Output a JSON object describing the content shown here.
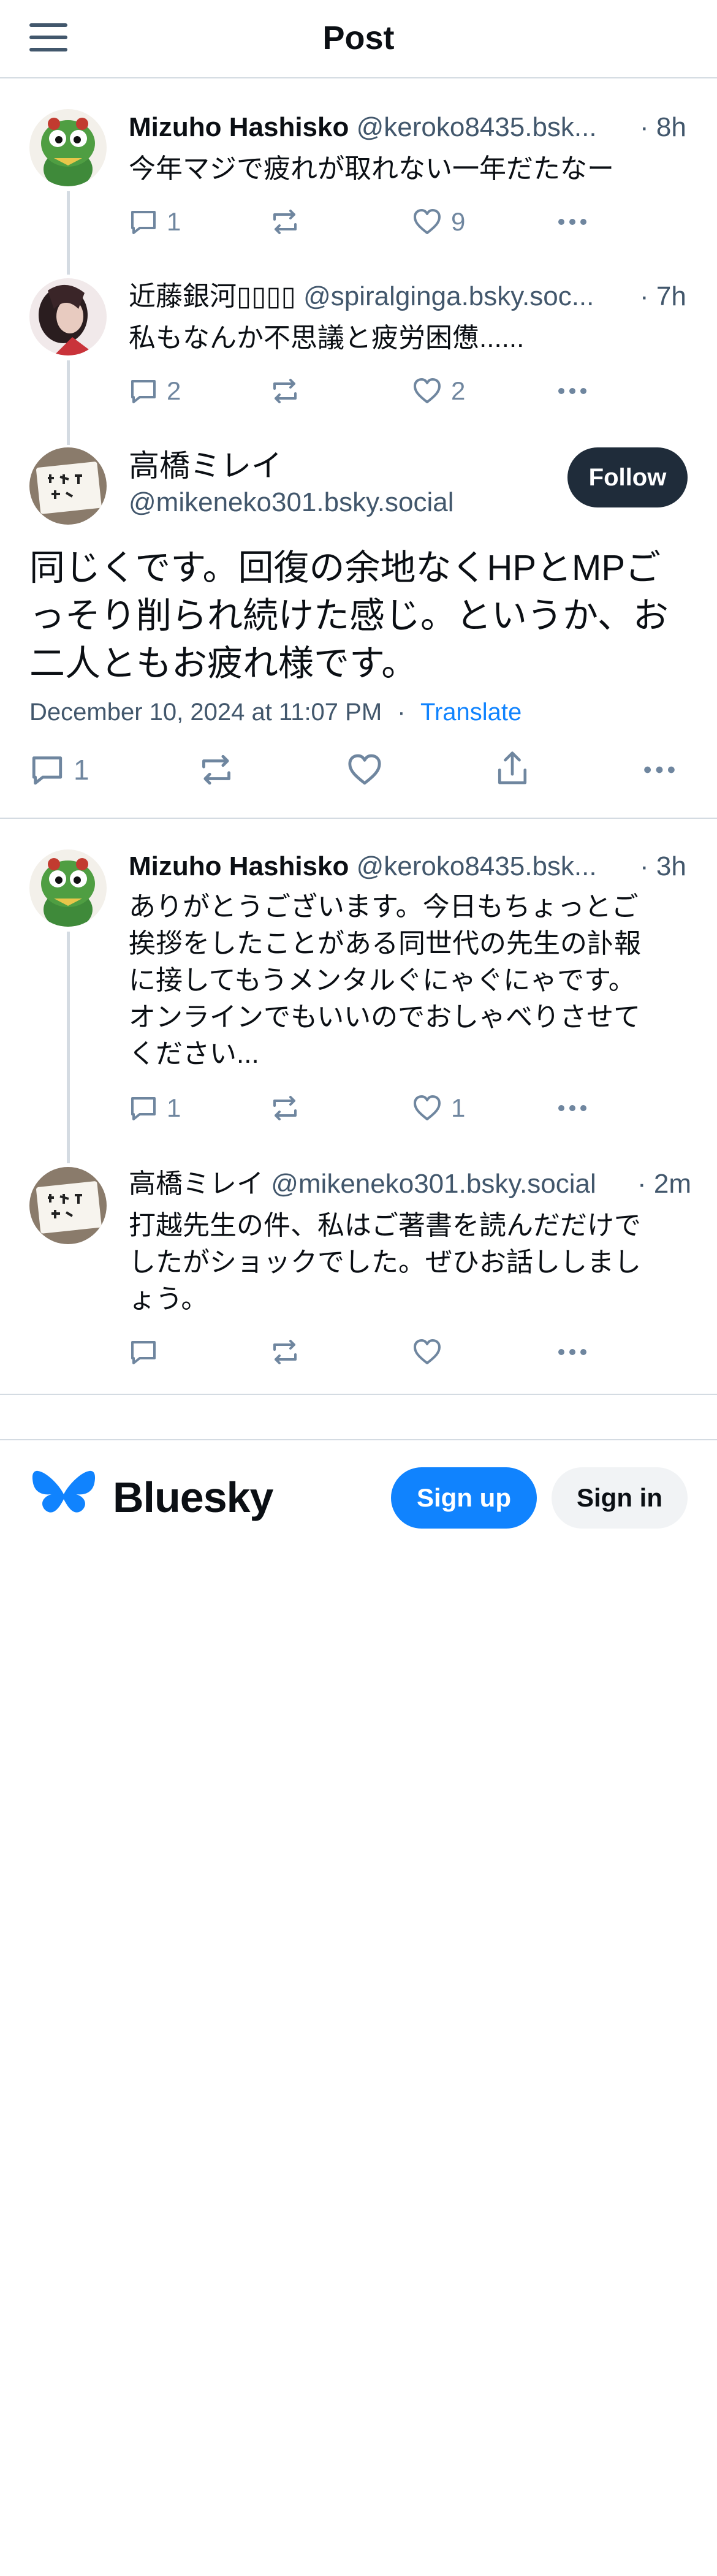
{
  "header": {
    "title": "Post",
    "menu_icon": "hamburger-menu-icon"
  },
  "posts": [
    {
      "author_name": "Mizuho Hashisko",
      "handle": "@keroko8435.bsk...",
      "time": "· 8h",
      "text": "今年マジで疲れが取れない一年だたなー",
      "replies": "1",
      "reposts": "",
      "likes": "9"
    },
    {
      "author_name": "近藤銀河",
      "author_emoji_glyphs": "▯▯▯▯",
      "handle": "@spiralginga.bsky.soc...",
      "time": "· 7h",
      "text": "私もなんか不思議と疲労困憊......",
      "replies": "2",
      "reposts": "",
      "likes": "2"
    }
  ],
  "main_post": {
    "author_name": "高橋ミレイ",
    "handle": "@mikeneko301.bsky.social",
    "follow_label": "Follow",
    "text": "同じくです。回復の余地なくHPとMPごっそり削られ続けた感じ。というか、お二人ともお疲れ様です。",
    "date": "December 10, 2024 at 11:07 PM",
    "separator": "·",
    "translate_label": "Translate",
    "replies": "1"
  },
  "replies": [
    {
      "author_name": "Mizuho Hashisko",
      "handle": "@keroko8435.bsk...",
      "time": "· 3h",
      "text_lines": [
        "ありがとうございます。今日もちょっとご",
        "挨拶をしたことがある同世代の先生の訃報",
        "に接してもうメンタルぐにゃぐにゃです。",
        "オンラインでもいいのでおしゃべりさせて",
        "ください..."
      ],
      "replies": "1",
      "likes": "1"
    },
    {
      "author_name": "高橋ミレイ",
      "handle": "@mikeneko301.bsky.social",
      "time": "· 2m",
      "text_lines": [
        "打越先生の件、私はご著書を読んだだけで",
        "したがショックでした。ぜひお話ししまし",
        "ょう。"
      ]
    }
  ],
  "footer": {
    "brand_name": "Bluesky",
    "signup_label": "Sign up",
    "signin_label": "Sign in",
    "brand_color": "#1083fe"
  }
}
